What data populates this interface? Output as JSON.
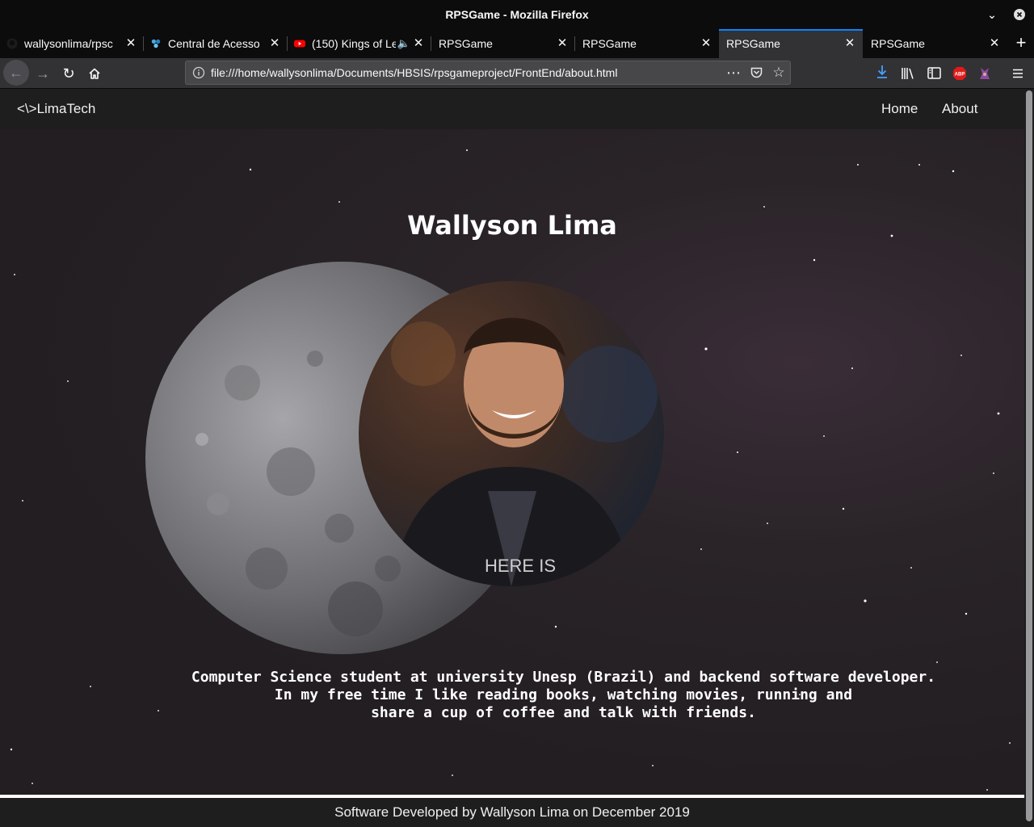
{
  "window": {
    "title": "RPSGame - Mozilla Firefox"
  },
  "tabs": [
    {
      "label": "wallysonlima/rpsc",
      "icon": "github-icon"
    },
    {
      "label": "Central de Acesso",
      "icon": "central-acesso-icon"
    },
    {
      "label": "(150) Kings of Le",
      "icon": "youtube-icon",
      "audio": "speaker-icon"
    },
    {
      "label": "RPSGame"
    },
    {
      "label": "RPSGame"
    },
    {
      "label": "RPSGame",
      "active": true
    },
    {
      "label": "RPSGame"
    }
  ],
  "address_bar": {
    "url": "file:///home/wallysonlima/Documents/HBSIS/rpsgameproject/FrontEnd/about.html"
  },
  "site": {
    "brand": "<\\>LimaTech",
    "nav": {
      "home": "Home",
      "about": "About"
    },
    "profile": {
      "name": "Wallyson Lima",
      "bio": "Computer Science student at university Unesp (Brazil) and backend software developer.\nIn my free time I like reading books, watching movies, running and\nshare a cup of coffee and talk with friends."
    },
    "footer": "Software Developed by Wallyson Lima on December 2019"
  },
  "photo_shirt_text": "HERE IS",
  "colors": {
    "accent": "#0a84ff",
    "chrome": "#0c0c0d",
    "toolbar": "#323234",
    "page_bg": "#262224"
  }
}
